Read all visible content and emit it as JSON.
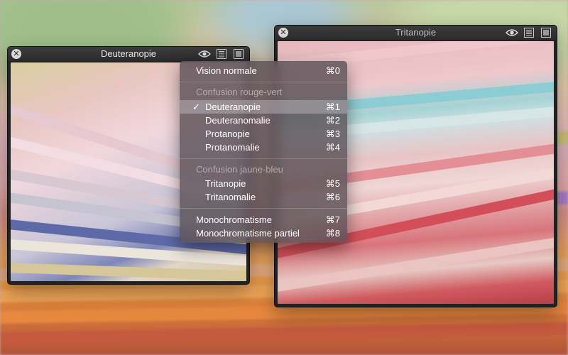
{
  "windows": {
    "left": {
      "title": "Deuteranopie"
    },
    "right": {
      "title": "Tritanopie"
    }
  },
  "menu": {
    "vision_normale": {
      "label": "Vision normale",
      "shortcut": "⌘0"
    },
    "group_rouge_vert": {
      "header": "Confusion rouge-vert",
      "items": [
        {
          "label": "Deuteranopie",
          "shortcut": "⌘1",
          "checked": true,
          "check_mark": "✓"
        },
        {
          "label": "Deuteranomalie",
          "shortcut": "⌘2"
        },
        {
          "label": "Protanopie",
          "shortcut": "⌘3"
        },
        {
          "label": "Protanomalie",
          "shortcut": "⌘4"
        }
      ]
    },
    "group_jaune_bleu": {
      "header": "Confusion jaune-bleu",
      "items": [
        {
          "label": "Tritanopie",
          "shortcut": "⌘5"
        },
        {
          "label": "Tritanomalie",
          "shortcut": "⌘6"
        }
      ]
    },
    "monochromatisme": {
      "label": "Monochromatisme",
      "shortcut": "⌘7"
    },
    "monochromatisme_partiel": {
      "label": "Monochromatisme partiel",
      "shortcut": "⌘8"
    }
  },
  "icons": {
    "close": "close-icon",
    "eye": "eye-icon",
    "list": "list-icon",
    "square": "square-icon"
  }
}
